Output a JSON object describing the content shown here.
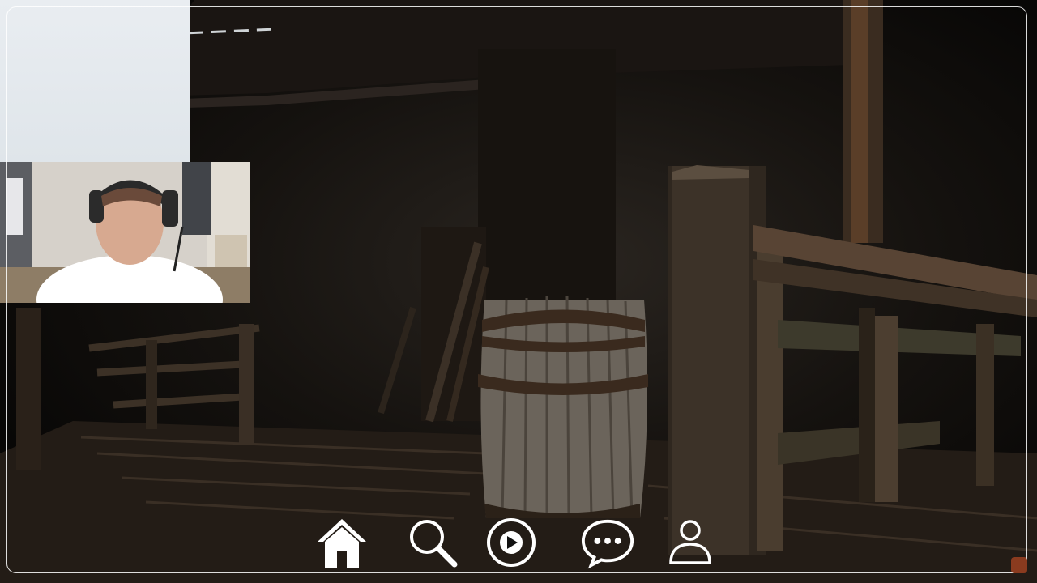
{
  "game": {
    "scene_description_icon": "wooden-dock-with-barrel-icon"
  },
  "webcam": {
    "icon": "streamer-webcam-icon"
  },
  "nav": {
    "items": [
      {
        "id": "home",
        "icon": "home-icon"
      },
      {
        "id": "search",
        "icon": "search-icon"
      },
      {
        "id": "play",
        "icon": "play-icon"
      },
      {
        "id": "chat",
        "icon": "chat-bubble-icon"
      },
      {
        "id": "profile",
        "icon": "user-icon"
      }
    ]
  },
  "colors": {
    "accent_white": "#ffffff",
    "wood_dark": "#2b231b",
    "wood_mid": "#4a3d2f",
    "barrel_band": "#3a2a1e"
  }
}
